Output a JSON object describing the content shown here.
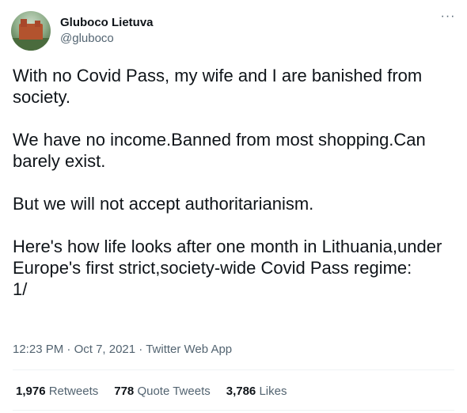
{
  "user": {
    "display_name": "Gluboco Lietuva",
    "handle": "@gluboco",
    "avatar_icon": "profile-avatar-castle"
  },
  "menu": {
    "more_label": "···"
  },
  "tweet": {
    "paragraphs": [
      "With no Covid Pass, my wife and I are banished from society.",
      "We have no income.Banned from most shopping.Can barely exist.",
      "But we will not accept authoritarianism.",
      "Here's how life looks after one month in Lithuania,under Europe's first strict,society-wide Covid Pass regime:",
      "1/"
    ]
  },
  "meta": {
    "time": "12:23 PM",
    "separator": " · ",
    "date": "Oct 7, 2021",
    "source": "Twitter Web App"
  },
  "stats": {
    "retweets_count": "1,976",
    "retweets_label": "Retweets",
    "quotes_count": "778",
    "quotes_label": "Quote Tweets",
    "likes_count": "3,786",
    "likes_label": "Likes"
  },
  "colors": {
    "text": "#0f1419",
    "secondary": "#536471",
    "divider": "#eff3f4"
  }
}
